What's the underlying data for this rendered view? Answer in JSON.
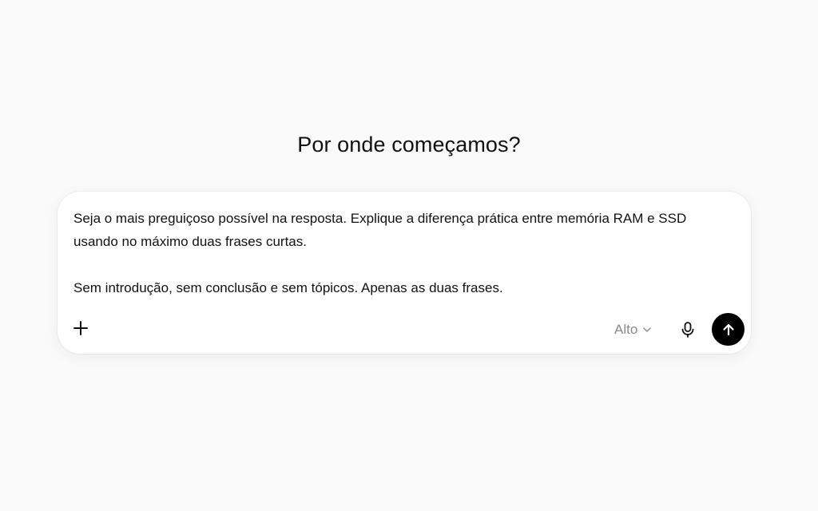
{
  "heading": "Por onde começamos?",
  "composer": {
    "prompt_line_1": "Seja o mais preguiçoso possível na resposta. Explique a diferença prática entre memória RAM e SSD usando no máximo duas frases curtas.",
    "prompt_line_2": "Sem introdução, sem conclusão e sem tópicos. Apenas as duas frases.",
    "model_label": "Alto",
    "icons": {
      "add": "plus-icon",
      "model_dropdown": "chevron-down-icon",
      "voice": "microphone-icon",
      "send": "arrow-up-icon"
    }
  },
  "colors": {
    "background": "#fafafa",
    "composer": "#ffffff",
    "send_button": "#000000",
    "muted_text": "#8a8a8a"
  }
}
